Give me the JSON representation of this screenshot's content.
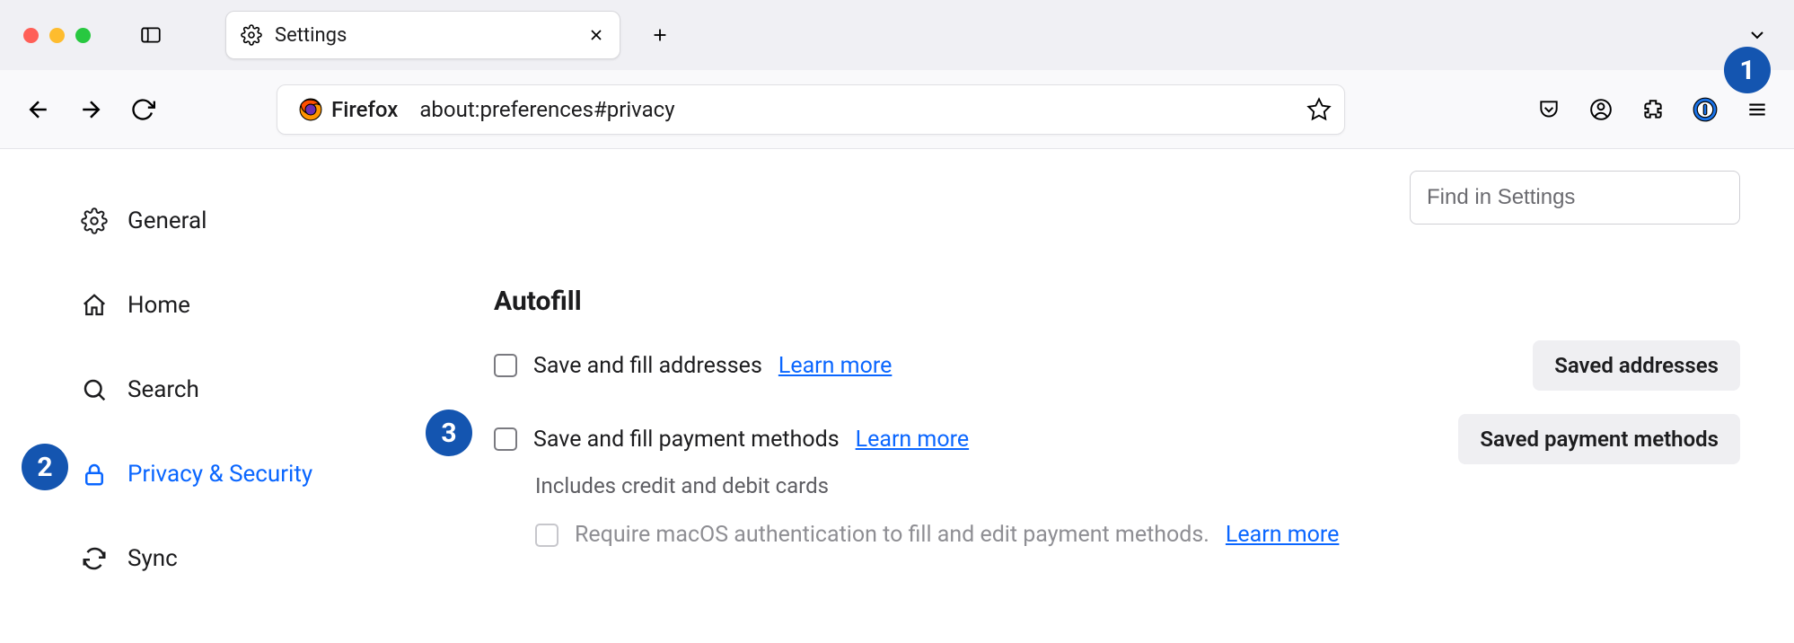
{
  "titlebar": {
    "tab_title": "Settings"
  },
  "toolbar": {
    "identity_label": "Firefox",
    "url": "about:preferences#privacy"
  },
  "find": {
    "placeholder": "Find in Settings"
  },
  "nav": {
    "items": [
      {
        "label": "General"
      },
      {
        "label": "Home"
      },
      {
        "label": "Search"
      },
      {
        "label": "Privacy & Security"
      },
      {
        "label": "Sync"
      }
    ]
  },
  "content": {
    "heading": "Autofill",
    "addresses": {
      "label": "Save and fill addresses",
      "learn": "Learn more",
      "button": "Saved addresses"
    },
    "payments": {
      "label": "Save and fill payment methods",
      "learn": "Learn more",
      "button": "Saved payment methods",
      "note": "Includes credit and debit cards",
      "require_auth": "Require macOS authentication to fill and edit payment methods.",
      "require_auth_learn": "Learn more"
    }
  },
  "badges": {
    "one": "1",
    "two": "2",
    "three": "3"
  }
}
